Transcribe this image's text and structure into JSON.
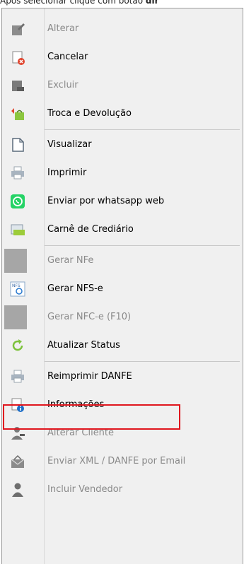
{
  "caption": {
    "prefix": "Após selecionar clique com  botão ",
    "bold": "dir"
  },
  "menu": {
    "items": [
      {
        "label": "Alterar",
        "icon": "edit-icon",
        "enabled": false
      },
      {
        "label": "Cancelar",
        "icon": "cancel-doc-icon",
        "enabled": true
      },
      {
        "label": "Excluir",
        "icon": "delete-icon",
        "enabled": false
      },
      {
        "label": "Troca e Devolução",
        "icon": "exchange-bag-icon",
        "enabled": true
      },
      {
        "label": "Visualizar",
        "icon": "page-icon",
        "enabled": true
      },
      {
        "label": "Imprimir",
        "icon": "printer-icon",
        "enabled": true
      },
      {
        "label": "Enviar por whatsapp web",
        "icon": "whatsapp-icon",
        "enabled": true
      },
      {
        "label": "Carnê de Crediário",
        "icon": "card-icon",
        "enabled": true
      },
      {
        "label": "Gerar NFe",
        "icon": "blank-gray-icon",
        "enabled": false
      },
      {
        "label": "Gerar NFS-e",
        "icon": "nfse-icon",
        "enabled": true
      },
      {
        "label": "Gerar NFC-e (F10)",
        "icon": "blank-gray-icon",
        "enabled": false
      },
      {
        "label": "Atualizar Status",
        "icon": "refresh-icon",
        "enabled": true
      },
      {
        "label": "Reimprimir DANFE",
        "icon": "printer-icon",
        "enabled": true,
        "highlighted": true
      },
      {
        "label": "Informações",
        "icon": "info-doc-icon",
        "enabled": true
      },
      {
        "label": "Alterar Cliente",
        "icon": "user-edit-icon",
        "enabled": false
      },
      {
        "label": "Enviar XML / DANFE por Email",
        "icon": "envelope-icon",
        "enabled": false
      },
      {
        "label": "Incluir Vendedor",
        "icon": "user-icon",
        "enabled": false
      }
    ]
  },
  "colors": {
    "highlight_border": "#e0161e",
    "menu_bg": "#f0f0f0",
    "disabled_text": "#8a8a8a",
    "whatsapp": "#25d366"
  }
}
